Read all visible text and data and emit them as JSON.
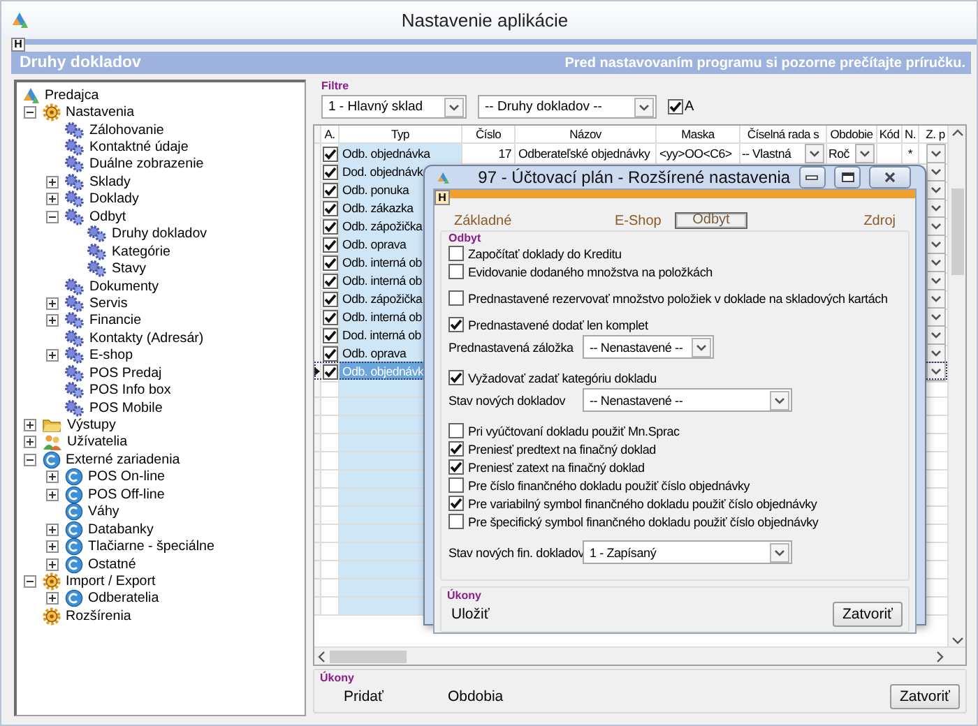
{
  "window": {
    "title": "Nastavenie aplikácie",
    "help_key": "H"
  },
  "header": {
    "title": "Druhy dokladov",
    "notice": "Pred nastavovaním programu si pozorne prečítajte príručku."
  },
  "tree": [
    {
      "label": "Predajca",
      "kind": "app",
      "children": [
        {
          "label": "Nastavenia",
          "kind": "settings",
          "expanded": true,
          "children": [
            {
              "label": "Zálohovanie",
              "kind": "gears"
            },
            {
              "label": "Kontaktné údaje",
              "kind": "gears"
            },
            {
              "label": "Duálne zobrazenie",
              "kind": "gears"
            },
            {
              "label": "Sklady",
              "kind": "gears",
              "expanded": false
            },
            {
              "label": "Doklady",
              "kind": "gears",
              "expanded": false
            },
            {
              "label": "Odbyt",
              "kind": "gears",
              "expanded": true,
              "children": [
                {
                  "label": "Druhy dokladov",
                  "kind": "gears"
                },
                {
                  "label": "Kategórie",
                  "kind": "gears"
                },
                {
                  "label": "Stavy",
                  "kind": "gears"
                }
              ]
            },
            {
              "label": "Dokumenty",
              "kind": "gears"
            },
            {
              "label": "Servis",
              "kind": "gears",
              "expanded": false
            },
            {
              "label": "Financie",
              "kind": "gears",
              "expanded": false
            },
            {
              "label": "Kontakty (Adresár)",
              "kind": "gears"
            },
            {
              "label": "E-shop",
              "kind": "gears",
              "expanded": false
            },
            {
              "label": "POS Predaj",
              "kind": "gears"
            },
            {
              "label": "POS Info box",
              "kind": "gears"
            },
            {
              "label": "POS Mobile",
              "kind": "gears"
            }
          ]
        },
        {
          "label": "Výstupy",
          "kind": "folder",
          "expanded": false
        },
        {
          "label": "Užívatelia",
          "kind": "users",
          "expanded": false
        },
        {
          "label": "Externé zariadenia",
          "kind": "device",
          "expanded": true,
          "children": [
            {
              "label": "POS On-line",
              "kind": "device",
              "expanded": false
            },
            {
              "label": "POS Off-line",
              "kind": "device",
              "expanded": false
            },
            {
              "label": "Váhy",
              "kind": "device"
            },
            {
              "label": "Databanky",
              "kind": "device",
              "expanded": false
            },
            {
              "label": "Tlačiarne - špeciálne",
              "kind": "device",
              "expanded": false
            },
            {
              "label": "Ostatné",
              "kind": "device",
              "expanded": false
            }
          ]
        },
        {
          "label": "Import / Export",
          "kind": "settings",
          "expanded": true,
          "children": [
            {
              "label": "Odberatelia",
              "kind": "device",
              "expanded": false
            }
          ]
        },
        {
          "label": "Rozšírenia",
          "kind": "settings"
        }
      ]
    }
  ],
  "filters": {
    "title": "Filtre",
    "warehouse": "1 - Hlavný sklad",
    "document_type": "-- Druhy dokladov --",
    "active_only": {
      "label": "A",
      "checked": true
    }
  },
  "table": {
    "columns": [
      "A.",
      "Typ",
      "Číslo",
      "Názov",
      "Maska",
      "Číselná rada s",
      "Obdobie",
      "Kód",
      "N.",
      "Z. p"
    ],
    "rows": [
      {
        "active": true,
        "selected": false,
        "type": "Odb. objednávka",
        "number": "17",
        "name": "Odberateľské objednávky",
        "mask": "<yy>OO<C6>",
        "series": "-- Vlastná",
        "period": "Roč",
        "n": "*"
      },
      {
        "active": true,
        "selected": false,
        "type": "Dod. objednávk"
      },
      {
        "active": true,
        "selected": false,
        "type": "Odb. ponuka"
      },
      {
        "active": true,
        "selected": false,
        "type": "Odb. zákazka"
      },
      {
        "active": true,
        "selected": false,
        "type": "Odb. zápožička"
      },
      {
        "active": true,
        "selected": false,
        "type": "Odb. oprava"
      },
      {
        "active": true,
        "selected": false,
        "type": "Odb. interná ob"
      },
      {
        "active": true,
        "selected": false,
        "type": "Odb. interná ob"
      },
      {
        "active": true,
        "selected": false,
        "type": "Odb. zápožička"
      },
      {
        "active": true,
        "selected": false,
        "type": "Odb. interná ob"
      },
      {
        "active": true,
        "selected": false,
        "type": "Dod. interná ob"
      },
      {
        "active": true,
        "selected": false,
        "type": "Odb. oprava"
      },
      {
        "active": true,
        "selected": true,
        "type": "Odb. objednávk"
      }
    ]
  },
  "actions": {
    "title": "Úkony",
    "buttons": [
      {
        "label": "Pridať",
        "kind": "link"
      },
      {
        "label": "Obdobia",
        "kind": "link"
      },
      {
        "label": "Zatvoriť",
        "kind": "button"
      }
    ]
  },
  "dialog": {
    "title": "97 - Účtovací plán - Rozšírené nastavenia",
    "help_key": "H",
    "tabs": [
      {
        "label": "Základné",
        "selected": false
      },
      {
        "label": "E-Shop",
        "selected": false
      },
      {
        "label": "Odbyt",
        "selected": true
      },
      {
        "label": "Zdroj",
        "selected": false
      }
    ],
    "group": "Odbyt",
    "sections": [
      [
        {
          "kind": "checkbox",
          "label": "Započítať doklady do Kreditu",
          "checked": false
        },
        {
          "kind": "checkbox",
          "label": "Evidovanie dodaného množstva na položkách",
          "checked": false
        }
      ],
      [
        {
          "kind": "checkbox",
          "label": "Prednastavené rezervovať množstvo položiek v doklade na skladových kartách",
          "checked": false
        }
      ],
      [
        {
          "kind": "checkbox",
          "label": "Prednastavené dodať len komplet",
          "checked": true
        },
        {
          "kind": "select",
          "label": "Prednastavená záložka",
          "value": "-- Nenastavené --"
        }
      ],
      [
        {
          "kind": "checkbox",
          "label": "Vyžadovať zadať kategóriu dokladu",
          "checked": true
        },
        {
          "kind": "select",
          "label": "Stav nových dokladov",
          "value": "-- Nenastavené --"
        }
      ],
      [
        {
          "kind": "checkbox",
          "label": "Pri vyúčtovaní dokladu použiť Mn.Sprac",
          "checked": false
        },
        {
          "kind": "checkbox",
          "label": "Preniesť predtext na finačný doklad",
          "checked": true
        },
        {
          "kind": "checkbox",
          "label": "Preniesť zatext na finačný doklad",
          "checked": true
        },
        {
          "kind": "checkbox",
          "label": "Pre číslo finančného dokladu použiť číslo objednávky",
          "checked": false
        },
        {
          "kind": "checkbox",
          "label": "Pre variabilný symbol finančného dokladu použiť číslo objednávky",
          "checked": true
        },
        {
          "kind": "checkbox",
          "label": "Pre špecifický symbol finančného dokladu použiť číslo objednávky",
          "checked": false
        }
      ],
      [
        {
          "kind": "select",
          "label": "Stav nových fin. dokladov",
          "value": "1 - Zapísaný"
        }
      ]
    ],
    "actions": {
      "title": "Úkony",
      "buttons": [
        {
          "label": "Uložiť",
          "kind": "link"
        },
        {
          "label": "Zatvoriť",
          "kind": "button"
        }
      ]
    }
  }
}
